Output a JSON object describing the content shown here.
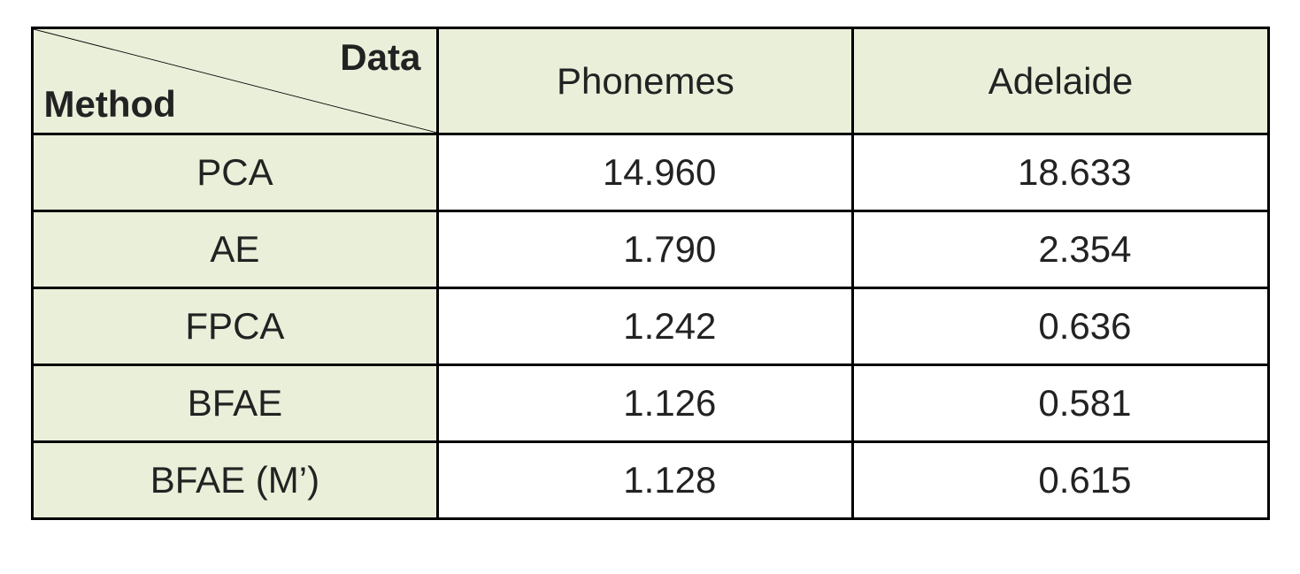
{
  "chart_data": {
    "type": "table",
    "title": "",
    "corner": {
      "top": "Data",
      "bottom": "Method"
    },
    "columns": [
      "Phonemes",
      "Adelaide"
    ],
    "rows": [
      {
        "method": "PCA",
        "values": [
          "14.960",
          "18.633"
        ]
      },
      {
        "method": "AE",
        "values": [
          "1.790",
          "2.354"
        ]
      },
      {
        "method": "FPCA",
        "values": [
          "1.242",
          "0.636"
        ]
      },
      {
        "method": "BFAE",
        "values": [
          "1.126",
          "0.581"
        ]
      },
      {
        "method": "BFAE (M’)",
        "values": [
          "1.128",
          "0.615"
        ]
      }
    ]
  }
}
